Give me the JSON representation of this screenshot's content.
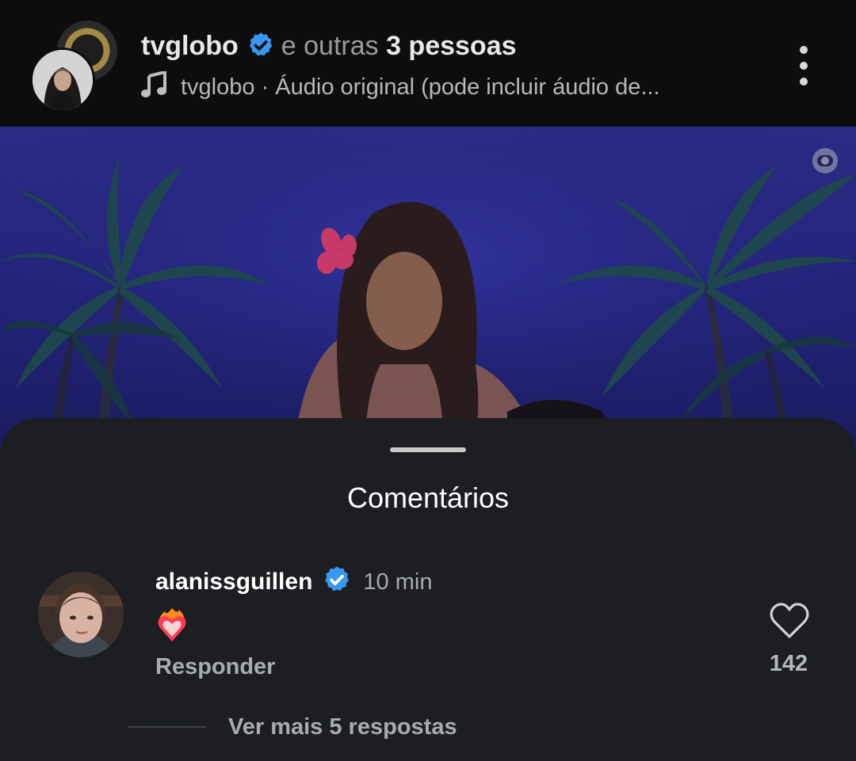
{
  "header": {
    "username": "tvglobo",
    "connector": "e outras",
    "others_count": "3 pessoas",
    "audio_text": "tvglobo · Áudio original (pode incluir áudio de..."
  },
  "comments_sheet": {
    "title": "Comentários",
    "comment": {
      "username": "alanissguillen",
      "time": "10 min",
      "reply_label": "Responder",
      "like_count": "142"
    },
    "view_more_label": "Ver mais 5 respostas"
  },
  "colors": {
    "verified_badge": "#3897f0",
    "sheet_background": "#1c1e22",
    "video_sky": "#2b2c86"
  }
}
